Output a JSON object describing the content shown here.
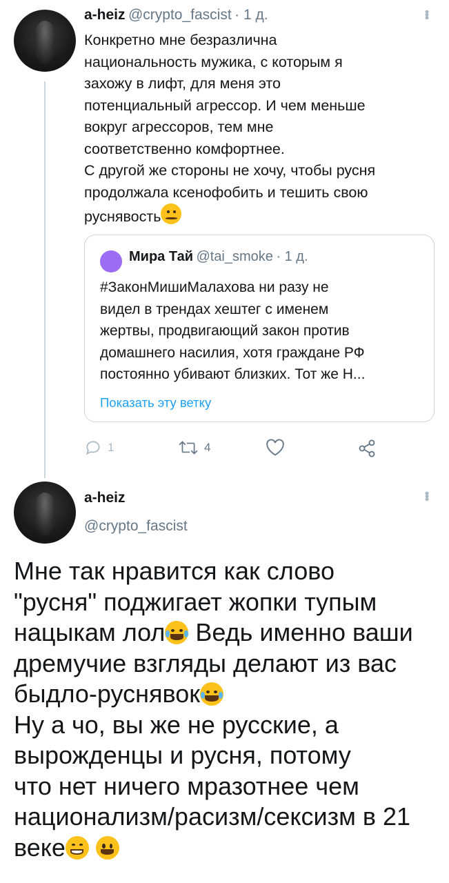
{
  "tweet1": {
    "name": "a-heiz",
    "handle": "@crypto_fascist",
    "time": "· 1 д.",
    "lines": [
      "Конкретно мне безразлична",
      "национальность мужика, с которым я",
      "захожу в лифт, для меня это",
      "потенциальный агрессор. И чем меньше",
      "вокруг агрессоров, тем мне",
      "соответственно комфортнее.",
      "С другой же стороны не хочу, чтобы русня",
      "продолжала ксенофобить и тешить свою",
      "руснявость"
    ],
    "quote": {
      "name": "Мира Тай",
      "handle": "@tai_smoke",
      "time": "· 1 д.",
      "lines": [
        "#ЗаконМишиМалахова ни разу не",
        "видел в трендах хештег с именем",
        "жертвы, продвигающий закон против",
        "домашнего насилия, хотя граждане РФ",
        "постоянно убивают близких. Тот же Н..."
      ],
      "show_thread": "Показать эту ветку"
    },
    "actions": {
      "replies": "1",
      "retweets": "4"
    }
  },
  "tweet2": {
    "name": "a-heiz",
    "handle": "@crypto_fascist",
    "lines": [
      "Мне так нравится как слово",
      "\"русня\" поджигает жопки тупым",
      "нацыкам лол",
      " Ведь именно ваши",
      "дремучие взгляды делают из вас",
      "быдло-руснявок",
      "Ну а чо, вы же не русские, а",
      "вырожденцы и русня, потому",
      "что нет ничего мразотнее чем",
      "национализм/расизм/сексизм в 21",
      "веке"
    ]
  },
  "colors": {
    "accent": "#1da1f2",
    "muted": "#657786",
    "border": "#ccd6dd",
    "text": "#14171a"
  },
  "icons": [
    "reply-icon",
    "retweet-icon",
    "like-icon",
    "share-icon",
    "more-icon",
    "thinking-emoji",
    "joy-emoji",
    "grin-emoji",
    "smiley-emoji"
  ]
}
